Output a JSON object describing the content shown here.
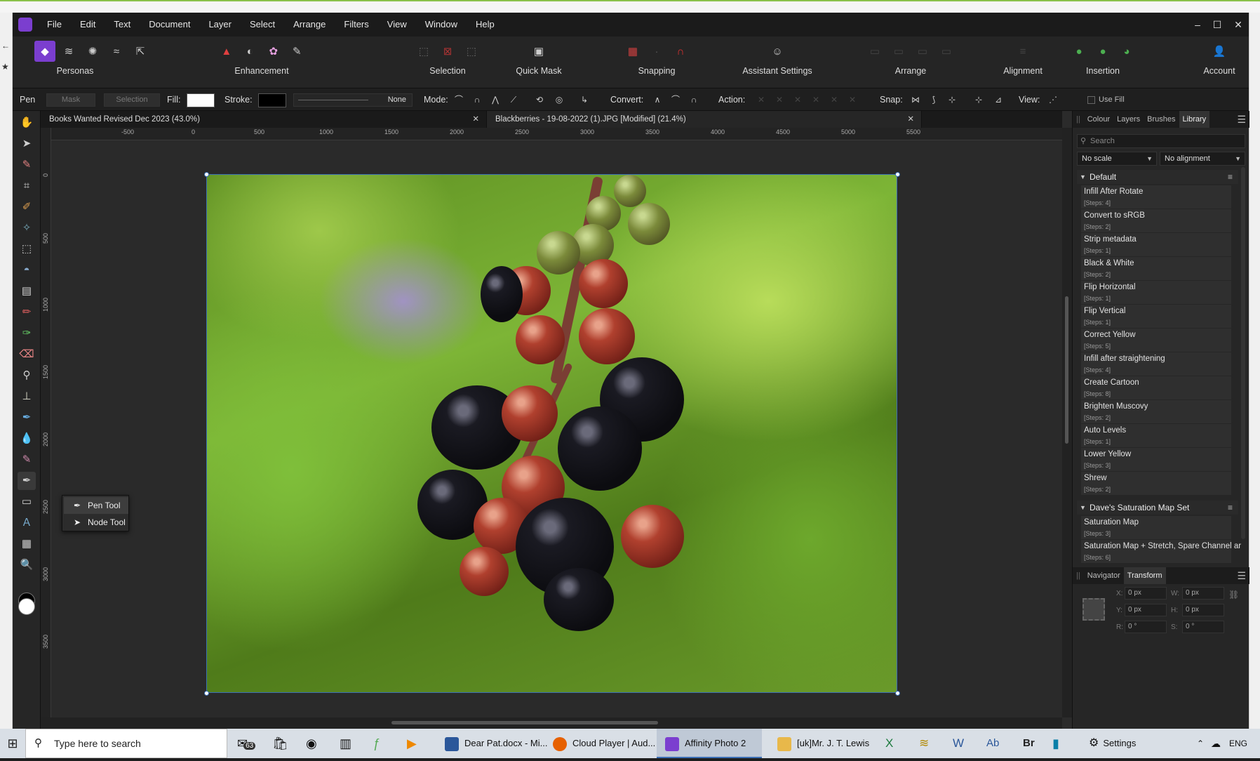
{
  "menu": [
    "File",
    "Edit",
    "Text",
    "Document",
    "Layer",
    "Select",
    "Arrange",
    "Filters",
    "View",
    "Window",
    "Help"
  ],
  "toolbar": {
    "personas_label": "Personas",
    "enhancement_label": "Enhancement",
    "selection_label": "Selection",
    "quickmask_label": "Quick Mask",
    "snapping_label": "Snapping",
    "assistant_label": "Assistant Settings",
    "arrange_label": "Arrange",
    "alignment_label": "Alignment",
    "insertion_label": "Insertion",
    "account_label": "Account"
  },
  "context": {
    "tool_name": "Pen",
    "mask": "Mask",
    "selection": "Selection",
    "fill": "Fill:",
    "stroke": "Stroke:",
    "none": "None",
    "mode": "Mode:",
    "convert": "Convert:",
    "action": "Action:",
    "snap": "Snap:",
    "view": "View:",
    "use_fill": "Use Fill",
    "fill_color": "#ffffff",
    "stroke_color": "#000000"
  },
  "tabs": [
    {
      "title": "Books Wanted Revised Dec 2023 (43.0%)"
    },
    {
      "title": "Blackberries - 19-08-2022 (1).JPG [Modified] (21.4%)"
    }
  ],
  "ruler": {
    "unit": "px",
    "top": [
      "-500",
      "0",
      "500",
      "1000",
      "1500",
      "2000",
      "2500",
      "3000",
      "3500",
      "4000",
      "4500",
      "5000",
      "5500"
    ],
    "left": [
      "0",
      "500",
      "1000",
      "1500",
      "2000",
      "2500",
      "3000",
      "3500"
    ]
  },
  "popup": {
    "pen": "Pen Tool",
    "node": "Node Tool"
  },
  "panel": {
    "tabs": [
      "Colour",
      "Layers",
      "Brushes",
      "Library"
    ],
    "search_placeholder": "Search",
    "scale": "No scale",
    "alignment": "No alignment",
    "groups": [
      {
        "name": "Default",
        "macros": [
          {
            "name": "Infill After Rotate",
            "steps": "[Steps: 4]"
          },
          {
            "name": "Convert to sRGB",
            "steps": "[Steps: 2]"
          },
          {
            "name": "Strip metadata",
            "steps": "[Steps: 1]"
          },
          {
            "name": "Black & White",
            "steps": "[Steps: 2]"
          },
          {
            "name": "Flip Horizontal",
            "steps": "[Steps: 1]"
          },
          {
            "name": "Flip Vertical",
            "steps": "[Steps: 1]"
          },
          {
            "name": "Correct Yellow",
            "steps": "[Steps: 5]"
          },
          {
            "name": "Infill after straightening",
            "steps": "[Steps: 4]"
          },
          {
            "name": "Create Cartoon",
            "steps": "[Steps: 8]"
          },
          {
            "name": "Brighten Muscovy",
            "steps": "[Steps: 2]"
          },
          {
            "name": "Auto Levels",
            "steps": "[Steps: 1]"
          },
          {
            "name": "Lower Yellow",
            "steps": "[Steps: 3]"
          },
          {
            "name": "Shrew",
            "steps": "[Steps: 2]"
          }
        ]
      },
      {
        "name": "Dave's Saturation Map Set",
        "macros": [
          {
            "name": "Saturation Map",
            "steps": "[Steps: 3]"
          },
          {
            "name": "Saturation Map + Stretch, Spare Channel ar",
            "steps": "[Steps: 6]"
          }
        ]
      }
    ],
    "bottom_tabs": [
      "Navigator",
      "Transform"
    ],
    "transform": {
      "x_label": "X:",
      "x": "0 px",
      "y_label": "Y:",
      "y": "0 px",
      "w_label": "W:",
      "w": "0 px",
      "h_label": "H:",
      "h": "0 px",
      "r_label": "R:",
      "r": "0 °",
      "s_label": "S:",
      "s": "0 °"
    }
  },
  "taskbar": {
    "search": "Type here to search",
    "mail_badge": "63",
    "items": [
      {
        "label": "Dear Pat.docx - Mi...",
        "color": "#2b579a"
      },
      {
        "label": "Cloud Player | Aud...",
        "color": "#e66000"
      },
      {
        "label": "Affinity Photo 2",
        "color": "#7b3ecf"
      },
      {
        "label": "[uk]Mr. J. T. Lewis",
        "color": "#e8b84a"
      }
    ],
    "settings": "Settings",
    "lang": "ENG"
  }
}
